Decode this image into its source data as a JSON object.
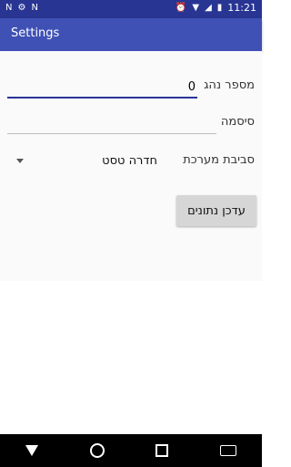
{
  "status_bar": {
    "time": "11:21",
    "icons": [
      "n-icon",
      "settings-icon",
      "n-icon",
      "alarm-icon",
      "wifi-icon",
      "signal-icon",
      "battery-icon"
    ]
  },
  "app_bar": {
    "title": "Settings"
  },
  "form": {
    "driver_number": {
      "label": "מספר נהג",
      "value": "0"
    },
    "password": {
      "label": "סיסמה",
      "value": ""
    },
    "environment": {
      "label": "סביבת מערכת",
      "selected": "חדרה טסט"
    },
    "update_button": "עדכן נתונים"
  },
  "colors": {
    "primary": "#3f51b5",
    "primary_dark": "#283593"
  }
}
